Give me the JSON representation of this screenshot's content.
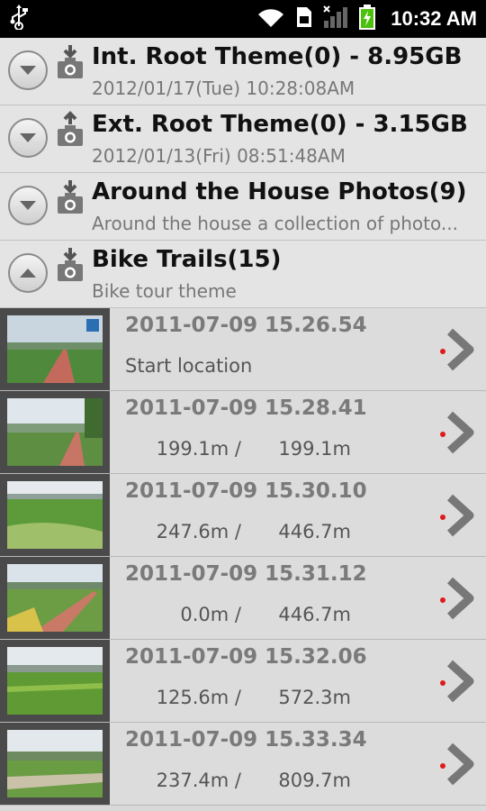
{
  "status_bar": {
    "time": "10:32 AM",
    "icons": [
      "usb-icon",
      "wifi-icon",
      "sim-icon",
      "signal-icon",
      "battery-charging-icon"
    ]
  },
  "themes": [
    {
      "title": "Int. Root Theme(0) -  8.95GB",
      "subtitle": "2012/01/17(Tue) 10:28:08AM",
      "expanded": false,
      "icon": "camera-download-icon"
    },
    {
      "title": "Ext. Root Theme(0) -  3.15GB",
      "subtitle": "2012/01/13(Fri) 08:51:48AM",
      "expanded": false,
      "icon": "camera-upload-icon"
    },
    {
      "title": "Around the House Photos(9)",
      "subtitle": "Around the house a collection of photo...",
      "expanded": false,
      "icon": "camera-download-icon"
    },
    {
      "title": "Bike Trails(15)",
      "subtitle": "Bike tour theme",
      "expanded": true,
      "icon": "camera-download-icon"
    }
  ],
  "photos": [
    {
      "timestamp": "2011-07-09 15.26.54",
      "note": "Start location",
      "dist": "",
      "total": ""
    },
    {
      "timestamp": "2011-07-09 15.28.41",
      "note": "",
      "dist": "199.1m /",
      "total": "199.1m"
    },
    {
      "timestamp": "2011-07-09 15.30.10",
      "note": "",
      "dist": "247.6m /",
      "total": "446.7m"
    },
    {
      "timestamp": "2011-07-09 15.31.12",
      "note": "",
      "dist": "0.0m /",
      "total": "446.7m"
    },
    {
      "timestamp": "2011-07-09 15.32.06",
      "note": "",
      "dist": "125.6m /",
      "total": "572.3m"
    },
    {
      "timestamp": "2011-07-09 15.33.34",
      "note": "",
      "dist": "237.4m /",
      "total": "809.7m"
    }
  ]
}
